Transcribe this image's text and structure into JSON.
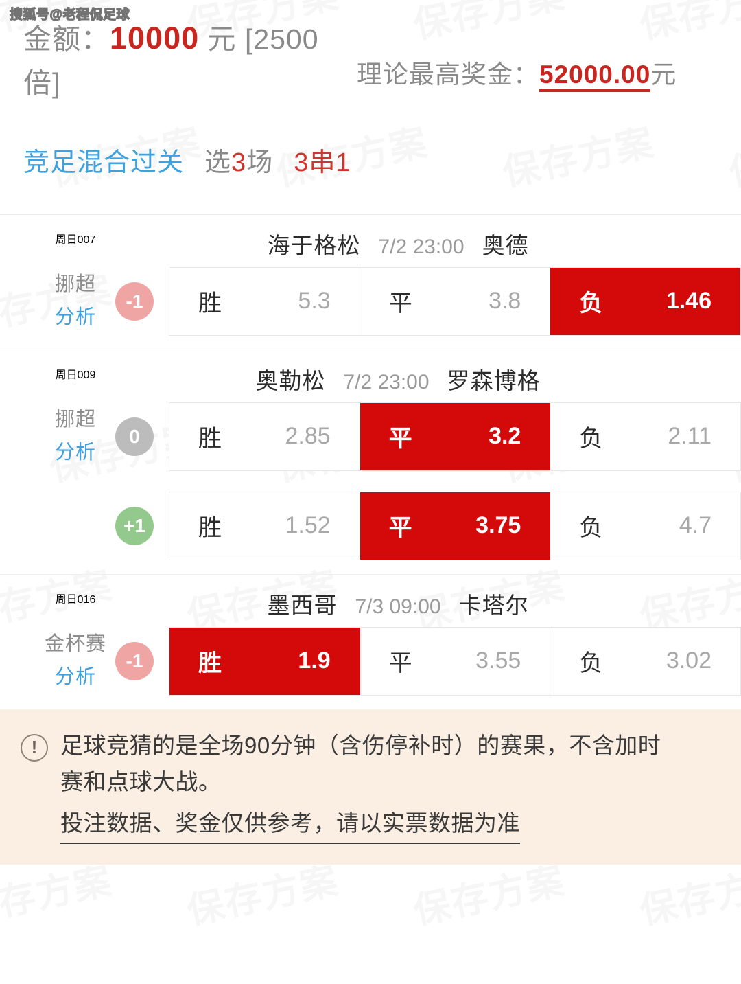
{
  "watermark": {
    "corner": "搜狐号@老程侃足球",
    "tile": "保存方案"
  },
  "header": {
    "amount_label": "金额：",
    "amount_value": "10000",
    "amount_unit": "元 [2500",
    "amount_unit2": "倍]",
    "bonus_label": "理论最高奖金：",
    "bonus_value": "52000.00",
    "bonus_unit": "元"
  },
  "playtype": {
    "name": "竞足混合过关",
    "count_prefix": "选",
    "count_num": "3",
    "count_suffix": "场",
    "pass": "3串1"
  },
  "matches": [
    {
      "issue": "周日007",
      "league": "挪超",
      "analysis": "分析",
      "home": "海于格松",
      "time": "7/2 23:00",
      "away": "奥德",
      "lines": [
        {
          "handicap": "-1",
          "handicap_type": "neg",
          "options": [
            {
              "label": "胜",
              "odd": "5.3",
              "selected": false
            },
            {
              "label": "平",
              "odd": "3.8",
              "selected": false
            },
            {
              "label": "负",
              "odd": "1.46",
              "selected": true
            }
          ]
        }
      ]
    },
    {
      "issue": "周日009",
      "league": "挪超",
      "analysis": "分析",
      "home": "奥勒松",
      "time": "7/2 23:00",
      "away": "罗森博格",
      "lines": [
        {
          "handicap": "0",
          "handicap_type": "zero",
          "options": [
            {
              "label": "胜",
              "odd": "2.85",
              "selected": false
            },
            {
              "label": "平",
              "odd": "3.2",
              "selected": true
            },
            {
              "label": "负",
              "odd": "2.11",
              "selected": false
            }
          ]
        },
        {
          "handicap": "+1",
          "handicap_type": "pos",
          "options": [
            {
              "label": "胜",
              "odd": "1.52",
              "selected": false
            },
            {
              "label": "平",
              "odd": "3.75",
              "selected": true
            },
            {
              "label": "负",
              "odd": "4.7",
              "selected": false
            }
          ]
        }
      ]
    },
    {
      "issue": "周日016",
      "league": "金杯赛",
      "analysis": "分析",
      "home": "墨西哥",
      "time": "7/3 09:00",
      "away": "卡塔尔",
      "lines": [
        {
          "handicap": "-1",
          "handicap_type": "neg",
          "options": [
            {
              "label": "胜",
              "odd": "1.9",
              "selected": true
            },
            {
              "label": "平",
              "odd": "3.55",
              "selected": false
            },
            {
              "label": "负",
              "odd": "3.02",
              "selected": false
            }
          ]
        }
      ]
    }
  ],
  "notice": {
    "icon": "exclamation-icon",
    "line1": "足球竞猜的是全场90分钟（含伤停补时）的赛果，不含加时",
    "line2": "赛和点球大战。",
    "line3": "投注数据、奖金仅供参考，请以实票数据为准"
  },
  "colors": {
    "accent_red": "#d40a0a",
    "link_blue": "#3fa2e0",
    "value_red": "#c9261f",
    "badge_neg": "#f0a5a5",
    "badge_zero": "#bcbcbc",
    "badge_pos": "#93c98d",
    "notice_bg": "#fbeee2"
  }
}
